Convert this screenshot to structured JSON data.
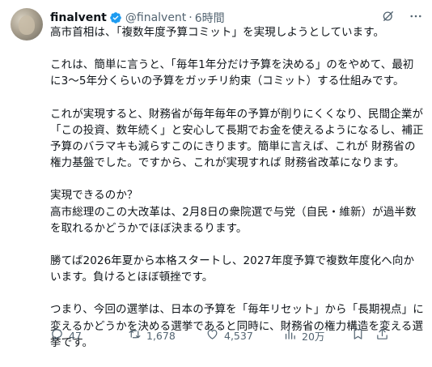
{
  "author": {
    "name": "finalvent",
    "handle": "@finalvent",
    "separator": "·",
    "time": "6時間"
  },
  "tweet": {
    "paragraphs": [
      "高市首相は、「複数年度予算コミット」を実現しようとしています。",
      "これは、簡単に言うと、「毎年1年分だけ予算を決める」のをやめて、最初に3〜5年分くらいの予算をガッチリ約束（コミット）する仕組みです。",
      "これが実現すると、財務省が毎年毎年の予算が削りにくくなり、民間企業が「この投資、数年続く」と安心して長期でお金を使えるようになるし、補正予算のバラマキも減らすこのにきります。簡単に言えば、これが 財務省の権力基盤でした。ですから、これが実現すれば 財務省改革になります。",
      "実現できるのか？\n高市総理のこの大改革は、2月8日の衆院選で与党（自民・維新）が過半数を取れるかどうかでほぼ決まるります。",
      "勝てば2026年夏から本格スタートし、2027年度予算で複数年度化へ向かいます。負けるとほぼ頓挫です。",
      "つまり、今回の選挙は、日本の予算を「毎年リセット」から「長期視点」に変えるかどうかを決める選挙であると同時に、財務省の権力構造を変える選挙です。"
    ]
  },
  "actions": {
    "replies": "47",
    "reposts": "1,678",
    "likes": "4,537",
    "views": "20万"
  },
  "colors": {
    "text": "#0f1419",
    "secondary": "#536471",
    "verified": "#1d9bf0"
  }
}
